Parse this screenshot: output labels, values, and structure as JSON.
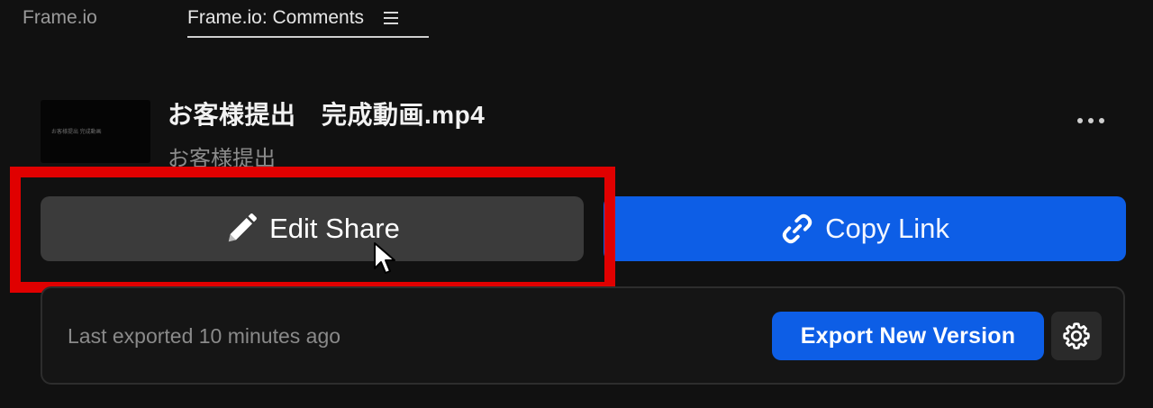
{
  "tabs": [
    {
      "label": "Frame.io"
    },
    {
      "label": "Frame.io: Comments"
    }
  ],
  "asset": {
    "title": "お客様提出　完成動画.mp4",
    "subtitle": "お客様提出",
    "thumbnail_text": "お客様提出 完成動画"
  },
  "actions": {
    "edit_share_label": "Edit Share",
    "copy_link_label": "Copy Link"
  },
  "export": {
    "status": "Last exported 10 minutes ago",
    "button_label": "Export New Version"
  },
  "colors": {
    "accent_blue": "#0d5ee6",
    "highlight_red": "#e00000",
    "background": "#111111"
  },
  "icons": {
    "menu": "hamburger-icon",
    "more": "ellipsis-icon",
    "edit": "pencil-icon",
    "copy": "link-icon",
    "settings": "gear-icon",
    "cursor": "mouse-pointer-icon"
  }
}
